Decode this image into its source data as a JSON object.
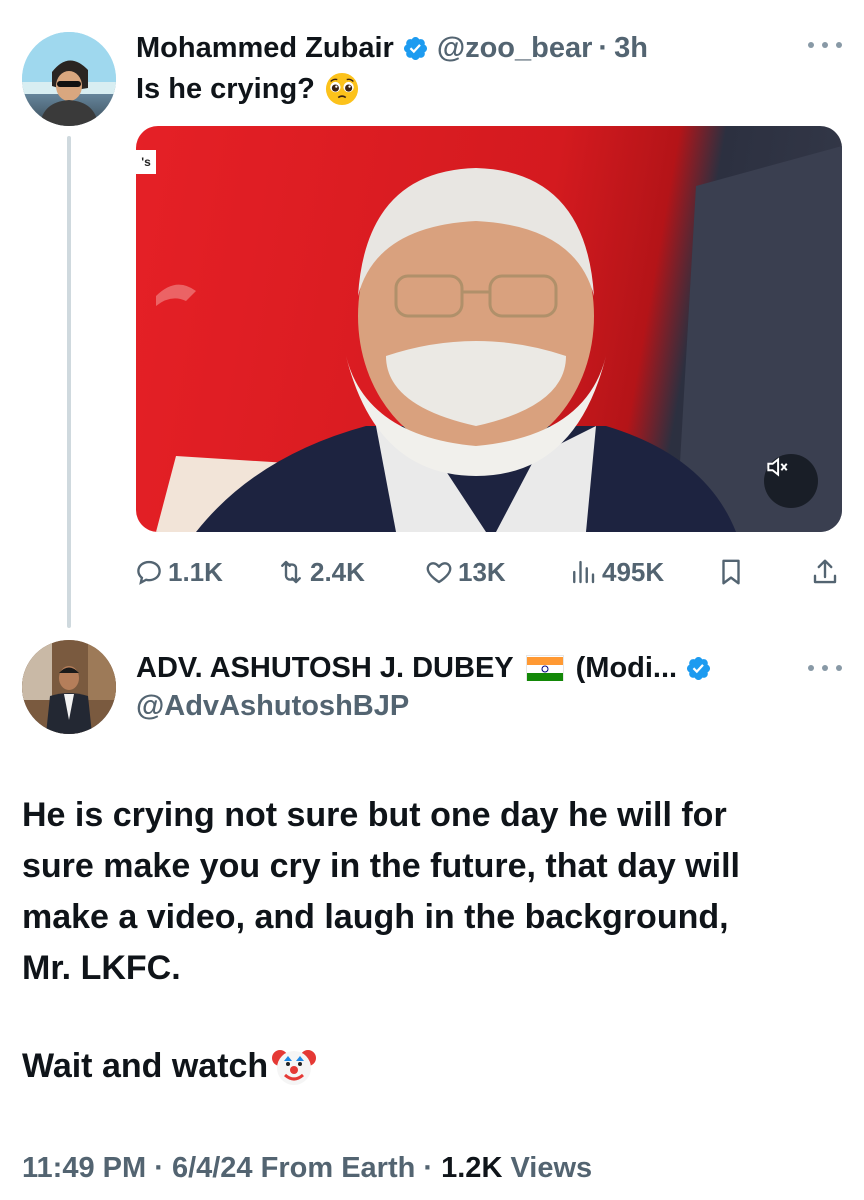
{
  "tweet1": {
    "author_name": "Mohammed Zubair",
    "handle": "@zoo_bear",
    "separator": "·",
    "time": "3h",
    "text": "Is he crying?",
    "media_corner_text": "'s",
    "stats": {
      "replies": "1.1K",
      "retweets": "2.4K",
      "likes": "13K",
      "views": "495K"
    }
  },
  "tweet2": {
    "author_name": "ADV. ASHUTOSH J. DUBEY",
    "author_suffix": "(Modi...",
    "handle": "@AdvAshutoshBJP",
    "body_lines": [
      "He is crying not sure but one day he will for",
      "sure make you cry in the future, that day will",
      "make a video, and laugh in the background,",
      "Mr. LKFC."
    ],
    "closing": "Wait and watch",
    "footer": {
      "time": "11:49 PM",
      "sep1": "·",
      "date": "6/4/24",
      "source": "From Earth",
      "sep2": "·",
      "views_count": "1.2K",
      "views_label": "Views"
    }
  },
  "colors": {
    "text": "#0f1419",
    "muted": "#536471",
    "verified": "#1d9bf0",
    "thread_line": "#cfd9de"
  },
  "icons": [
    "verified-badge-icon",
    "more-options-icon",
    "reply-icon",
    "retweet-icon",
    "like-icon",
    "views-icon",
    "bookmark-icon",
    "share-icon",
    "mute-icon",
    "india-flag-icon",
    "pleading-face-emoji",
    "clown-face-emoji"
  ]
}
